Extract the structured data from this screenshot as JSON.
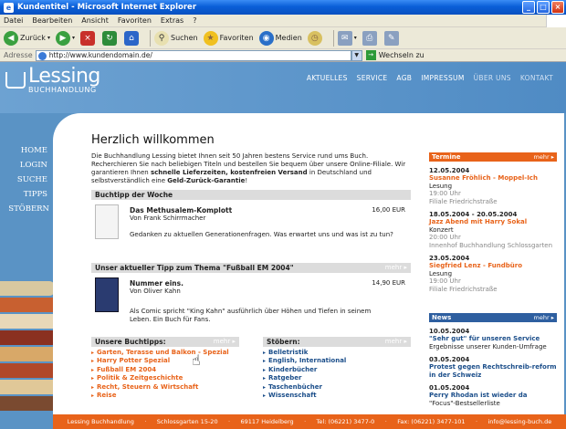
{
  "window": {
    "title": "Kundentitel - Microsoft Internet Explorer"
  },
  "menu": [
    "Datei",
    "Bearbeiten",
    "Ansicht",
    "Favoriten",
    "Extras",
    "?"
  ],
  "toolbar": {
    "back": "Zurück",
    "search": "Suchen",
    "favorites": "Favoriten",
    "media": "Medien"
  },
  "address": {
    "label": "Adresse",
    "url": "http://www.kundendomain.de/",
    "go": "Wechseln zu"
  },
  "site": {
    "logo_name": "Lessing",
    "logo_sub": "BUCHHANDLUNG",
    "topnav": [
      "AKTUELLES",
      "SERVICE",
      "AGB",
      "IMPRESSUM",
      "ÜBER UNS",
      "KONTAKT"
    ],
    "sidenav": [
      "HOME",
      "LOGIN",
      "SUCHE",
      "TIPPS",
      "STÖBERN"
    ]
  },
  "main": {
    "heading": "Herzlich willkommen",
    "intro_1": "Die Buchhandlung Lessing bietet Ihnen seit 50 Jahren bestens Service rund ums Buch. Recherchieren Sie nach beliebigen Titeln und bestellen Sie bequem über unsere Online-Filiale. Wir garantieren Ihnen ",
    "intro_bold": "schnelle Lieferzeiten, kostenfreien Versand",
    "intro_2": " in Deutschland und selbstverständlich eine ",
    "intro_bold_2": "Geld-Zurück-Garantie",
    "intro_3": "!",
    "tip1": {
      "head": "Buchtipp der Woche",
      "title": "Das Methusalem-Komplott",
      "author": "Von Frank Schirrmacher",
      "price": "16,00 EUR",
      "desc": "Gedanken zu aktuellen Generationenfragen. Was erwartet uns und was ist zu tun?"
    },
    "tip2": {
      "head": "Unser aktueller Tipp zum Thema \"Fußball EM 2004\"",
      "more": "mehr",
      "title": "Nummer eins.",
      "author": "Von Oliver Kahn",
      "price": "14,90 EUR",
      "desc": "Als Comic spricht \"King Kahn\" ausführlich über Höhen und Tiefen in seinem Leben. Ein Buch für Fans."
    },
    "buchtipps": {
      "head": "Unsere Buchtipps:",
      "more": "mehr",
      "items": [
        "Garten, Terasse und Balkon - Spezial",
        "Harry Potter Spezial",
        "Fußball EM 2004",
        "Politik & Zeitgeschichte",
        "Recht, Steuern & Wirtschaft",
        "Reise"
      ]
    },
    "stoebern": {
      "head": "Stöbern:",
      "more": "mehr",
      "items": [
        "Belletristik",
        "English, International",
        "Kinderbücher",
        "Ratgeber",
        "Taschenbücher",
        "Wissenschaft"
      ]
    }
  },
  "termine": {
    "head": "Termine",
    "more": "mehr",
    "events": [
      {
        "date": "12.05.2004",
        "title": "Susanne Fröhlich - Moppel-Ich",
        "type": "Lesung",
        "time": "19:00 Uhr",
        "place": "Filiale Friedrichstraße"
      },
      {
        "date": "18.05.2004 - 20.05.2004",
        "title": "Jazz Abend mit Harry Sokal",
        "type": "Konzert",
        "time": "20:00 Uhr",
        "place": "Innenhof Buchhandlung Schlossgarten"
      },
      {
        "date": "23.05.2004",
        "title": "Siegfried Lenz - Fundbüro",
        "type": "Lesung",
        "time": "19:00 Uhr",
        "place": "Filiale Friedrichstraße"
      }
    ]
  },
  "news": {
    "head": "News",
    "more": "mehr",
    "items": [
      {
        "date": "10.05.2004",
        "title": "\"Sehr gut\" für unseren Service",
        "text": "Ergebnisse unserer Kunden-Umfrage"
      },
      {
        "date": "03.05.2004",
        "title": "Protest gegen Rechtschreib-reform in der Schweiz",
        "text": ""
      },
      {
        "date": "01.05.2004",
        "title": "Perry Rhodan ist wieder da",
        "text": "\"Focus\"-Bestsellerliste"
      }
    ]
  },
  "footer": [
    "Lessing Buchhandlung",
    "Schlossgarten 15-20",
    "69117 Heidelberg",
    "Tel: (06221) 3477-0",
    "Fax: (06221) 3477-101",
    "info@lessing-buch.de"
  ],
  "colors": {
    "accent": "#e8631a",
    "blue": "#2e5fa0",
    "header": "#5a93c5"
  }
}
